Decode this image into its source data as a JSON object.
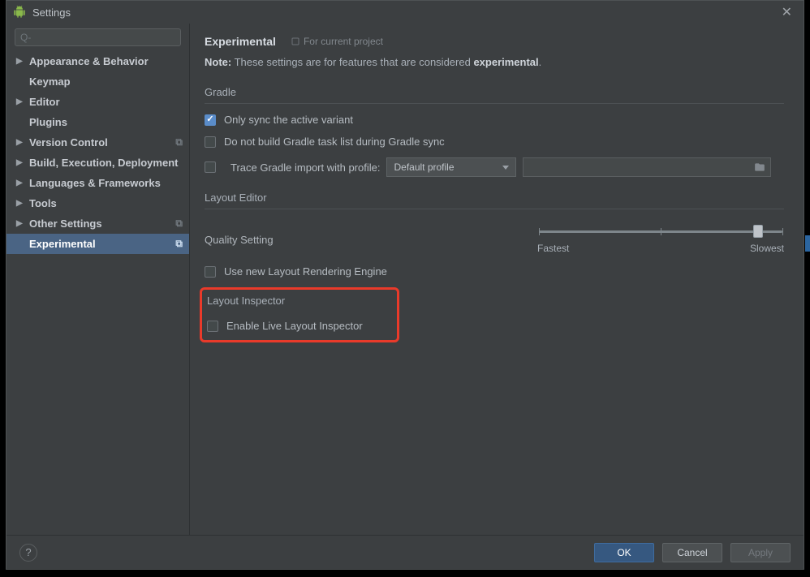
{
  "titlebar": {
    "title": "Settings"
  },
  "search": {
    "placeholder": "Q-"
  },
  "sidebar": {
    "items": [
      {
        "label": "Appearance & Behavior",
        "expandable": true
      },
      {
        "label": "Keymap",
        "expandable": false
      },
      {
        "label": "Editor",
        "expandable": true
      },
      {
        "label": "Plugins",
        "expandable": false
      },
      {
        "label": "Version Control",
        "expandable": true,
        "project_badge": true
      },
      {
        "label": "Build, Execution, Deployment",
        "expandable": true
      },
      {
        "label": "Languages & Frameworks",
        "expandable": true
      },
      {
        "label": "Tools",
        "expandable": true
      },
      {
        "label": "Other Settings",
        "expandable": true,
        "project_badge": true
      },
      {
        "label": "Experimental",
        "expandable": false,
        "selected": true,
        "project_badge": true,
        "child": true
      }
    ]
  },
  "header": {
    "title": "Experimental",
    "scope": "For current project"
  },
  "note": {
    "prefix": "Note:",
    "body": " These settings are for features that are considered ",
    "bold": "experimental",
    "suffix": "."
  },
  "sections": {
    "gradle": {
      "title": "Gradle",
      "only_sync": "Only sync the active variant",
      "no_task_list": "Do not build Gradle task list during Gradle sync",
      "trace_label": "Trace Gradle import with profile:",
      "profile_select": "Default profile"
    },
    "layout_editor": {
      "title": "Layout Editor",
      "quality_label": "Quality Setting",
      "slider_min": "Fastest",
      "slider_max": "Slowest",
      "new_engine": "Use new Layout Rendering Engine"
    },
    "layout_inspector": {
      "title": "Layout Inspector",
      "enable_live": "Enable Live Layout Inspector"
    }
  },
  "footer": {
    "ok": "OK",
    "cancel": "Cancel",
    "apply": "Apply"
  }
}
